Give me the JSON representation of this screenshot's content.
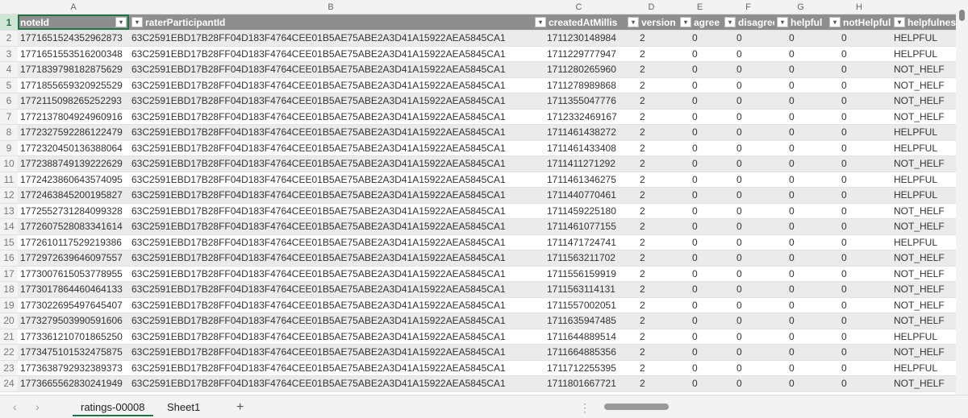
{
  "column_letters": [
    "",
    "A",
    "B",
    "C",
    "D",
    "E",
    "F",
    "G",
    "H",
    ""
  ],
  "headers": [
    "noteId",
    "raterParticipantId",
    "createdAtMillis",
    "version",
    "agree",
    "disagree",
    "helpful",
    "notHelpful",
    "helpfulnes"
  ],
  "rows": [
    [
      "1771651524352962873",
      "63C2591EBD17B28FF04D183F4764CEE01B5AE75ABE2A3D41A15922AEA5845CA1",
      "1711230148984",
      "2",
      "0",
      "0",
      "0",
      "0",
      "HELPFUL"
    ],
    [
      "1771651553516200348",
      "63C2591EBD17B28FF04D183F4764CEE01B5AE75ABE2A3D41A15922AEA5845CA1",
      "1711229777947",
      "2",
      "0",
      "0",
      "0",
      "0",
      "HELPFUL"
    ],
    [
      "1771839798182875629",
      "63C2591EBD17B28FF04D183F4764CEE01B5AE75ABE2A3D41A15922AEA5845CA1",
      "1711280265960",
      "2",
      "0",
      "0",
      "0",
      "0",
      "NOT_HELF"
    ],
    [
      "1771855659320925529",
      "63C2591EBD17B28FF04D183F4764CEE01B5AE75ABE2A3D41A15922AEA5845CA1",
      "1711278989868",
      "2",
      "0",
      "0",
      "0",
      "0",
      "NOT_HELF"
    ],
    [
      "1772115098265252293",
      "63C2591EBD17B28FF04D183F4764CEE01B5AE75ABE2A3D41A15922AEA5845CA1",
      "1711355047776",
      "2",
      "0",
      "0",
      "0",
      "0",
      "NOT_HELF"
    ],
    [
      "1772137804924960916",
      "63C2591EBD17B28FF04D183F4764CEE01B5AE75ABE2A3D41A15922AEA5845CA1",
      "1712332469167",
      "2",
      "0",
      "0",
      "0",
      "0",
      "NOT_HELF"
    ],
    [
      "1772327592286122479",
      "63C2591EBD17B28FF04D183F4764CEE01B5AE75ABE2A3D41A15922AEA5845CA1",
      "1711461438272",
      "2",
      "0",
      "0",
      "0",
      "0",
      "HELPFUL"
    ],
    [
      "1772320450136388064",
      "63C2591EBD17B28FF04D183F4764CEE01B5AE75ABE2A3D41A15922AEA5845CA1",
      "1711461433408",
      "2",
      "0",
      "0",
      "0",
      "0",
      "HELPFUL"
    ],
    [
      "1772388749139222629",
      "63C2591EBD17B28FF04D183F4764CEE01B5AE75ABE2A3D41A15922AEA5845CA1",
      "1711411271292",
      "2",
      "0",
      "0",
      "0",
      "0",
      "NOT_HELF"
    ],
    [
      "1772423860643574095",
      "63C2591EBD17B28FF04D183F4764CEE01B5AE75ABE2A3D41A15922AEA5845CA1",
      "1711461346275",
      "2",
      "0",
      "0",
      "0",
      "0",
      "HELPFUL"
    ],
    [
      "1772463845200195827",
      "63C2591EBD17B28FF04D183F4764CEE01B5AE75ABE2A3D41A15922AEA5845CA1",
      "1711440770461",
      "2",
      "0",
      "0",
      "0",
      "0",
      "HELPFUL"
    ],
    [
      "1772552731284099328",
      "63C2591EBD17B28FF04D183F4764CEE01B5AE75ABE2A3D41A15922AEA5845CA1",
      "1711459225180",
      "2",
      "0",
      "0",
      "0",
      "0",
      "NOT_HELF"
    ],
    [
      "1772607528083341614",
      "63C2591EBD17B28FF04D183F4764CEE01B5AE75ABE2A3D41A15922AEA5845CA1",
      "1711461077155",
      "2",
      "0",
      "0",
      "0",
      "0",
      "NOT_HELF"
    ],
    [
      "1772610117529219386",
      "63C2591EBD17B28FF04D183F4764CEE01B5AE75ABE2A3D41A15922AEA5845CA1",
      "1711471724741",
      "2",
      "0",
      "0",
      "0",
      "0",
      "HELPFUL"
    ],
    [
      "1772972639646097557",
      "63C2591EBD17B28FF04D183F4764CEE01B5AE75ABE2A3D41A15922AEA5845CA1",
      "1711563211702",
      "2",
      "0",
      "0",
      "0",
      "0",
      "NOT_HELF"
    ],
    [
      "1773007615053778955",
      "63C2591EBD17B28FF04D183F4764CEE01B5AE75ABE2A3D41A15922AEA5845CA1",
      "1711556159919",
      "2",
      "0",
      "0",
      "0",
      "0",
      "NOT_HELF"
    ],
    [
      "1773017864460464133",
      "63C2591EBD17B28FF04D183F4764CEE01B5AE75ABE2A3D41A15922AEA5845CA1",
      "1711563114131",
      "2",
      "0",
      "0",
      "0",
      "0",
      "NOT_HELF"
    ],
    [
      "1773022695497645407",
      "63C2591EBD17B28FF04D183F4764CEE01B5AE75ABE2A3D41A15922AEA5845CA1",
      "1711557002051",
      "2",
      "0",
      "0",
      "0",
      "0",
      "NOT_HELF"
    ],
    [
      "1773279503990591606",
      "63C2591EBD17B28FF04D183F4764CEE01B5AE75ABE2A3D41A15922AEA5845CA1",
      "1711635947485",
      "2",
      "0",
      "0",
      "0",
      "0",
      "NOT_HELF"
    ],
    [
      "1773361210701865250",
      "63C2591EBD17B28FF04D183F4764CEE01B5AE75ABE2A3D41A15922AEA5845CA1",
      "1711644889514",
      "2",
      "0",
      "0",
      "0",
      "0",
      "HELPFUL"
    ],
    [
      "1773475101532475875",
      "63C2591EBD17B28FF04D183F4764CEE01B5AE75ABE2A3D41A15922AEA5845CA1",
      "1711664885356",
      "2",
      "0",
      "0",
      "0",
      "0",
      "NOT_HELF"
    ],
    [
      "1773638792932389373",
      "63C2591EBD17B28FF04D183F4764CEE01B5AE75ABE2A3D41A15922AEA5845CA1",
      "1711712255395",
      "2",
      "0",
      "0",
      "0",
      "0",
      "HELPFUL"
    ],
    [
      "1773665562830241949",
      "63C2591EBD17B28FF04D183F4764CEE01B5AE75ABE2A3D41A15922AEA5845CA1",
      "1711801667721",
      "2",
      "0",
      "0",
      "0",
      "0",
      "NOT_HELF"
    ]
  ],
  "sheet_tabs": {
    "active": "ratings-00008",
    "other": "Sheet1",
    "add": "+",
    "prev": "‹",
    "next": "›",
    "more": "⋮"
  },
  "colors": {
    "header_bg": "#8e8e8e",
    "selection": "#217346",
    "alt_row": "#ebebeb"
  }
}
